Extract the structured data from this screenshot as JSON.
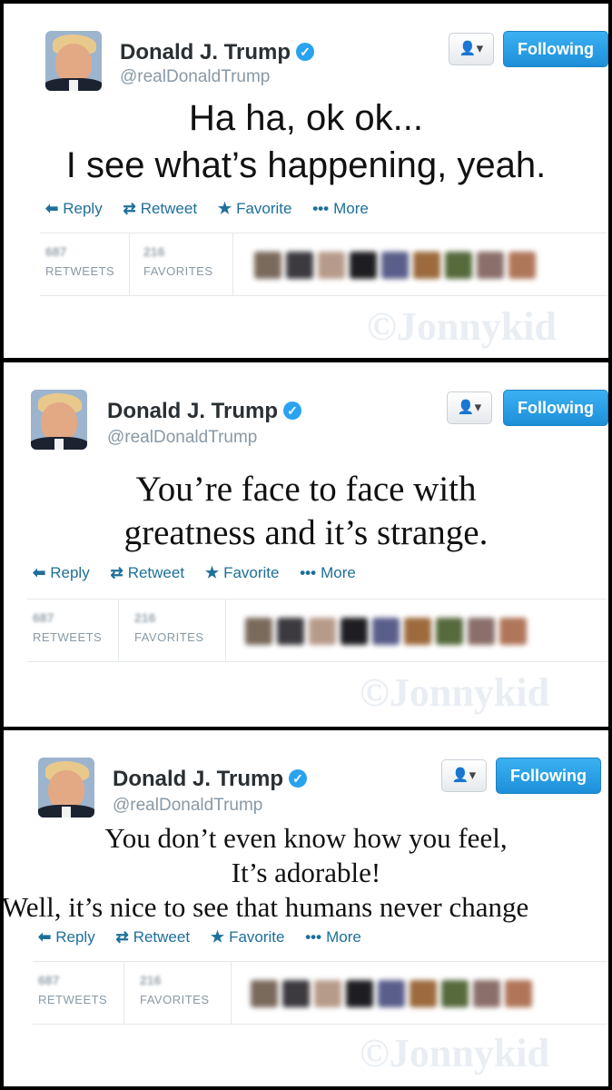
{
  "panels": [
    {
      "name": "Donald J. Trump",
      "handle": "@realDonaldTrump",
      "follow_label": "Following",
      "tweet_lines": [
        "Ha ha, ok ok...",
        "I see what’s happening, yeah."
      ],
      "actions": {
        "reply": "Reply",
        "retweet": "Retweet",
        "favorite": "Favorite",
        "more": "More"
      },
      "stats": {
        "retweets_count": "687",
        "retweets_label": "RETWEETS",
        "favorites_count": "216",
        "favorites_label": "FAVORITES"
      },
      "watermark": "©Jonnykid"
    },
    {
      "name": "Donald J. Trump",
      "handle": "@realDonaldTrump",
      "follow_label": "Following",
      "tweet_lines": [
        "You’re face to face with",
        "greatness and it’s strange."
      ],
      "actions": {
        "reply": "Reply",
        "retweet": "Retweet",
        "favorite": "Favorite",
        "more": "More"
      },
      "stats": {
        "retweets_count": "687",
        "retweets_label": "RETWEETS",
        "favorites_count": "216",
        "favorites_label": "FAVORITES"
      },
      "watermark": "©Jonnykid"
    },
    {
      "name": "Donald J. Trump",
      "handle": "@realDonaldTrump",
      "follow_label": "Following",
      "tweet_lines": [
        "You don’t even know how you feel,",
        "It’s adorable!",
        "Well, it’s nice to see that humans never change"
      ],
      "actions": {
        "reply": "Reply",
        "retweet": "Retweet",
        "favorite": "Favorite",
        "more": "More"
      },
      "stats": {
        "retweets_count": "687",
        "retweets_label": "RETWEETS",
        "favorites_count": "216",
        "favorites_label": "FAVORITES"
      },
      "watermark": "©Jonnykid"
    }
  ],
  "icons": {
    "reply": "reply-arrow-icon",
    "retweet": "retweet-icon",
    "favorite": "star-icon",
    "more": "ellipsis-icon",
    "verified": "verified-badge-icon",
    "user": "user-dropdown-icon"
  },
  "colors": {
    "follow_button": "#1d8fd9",
    "action_text": "#1d6f9a",
    "verified": "#2aa3ef"
  }
}
